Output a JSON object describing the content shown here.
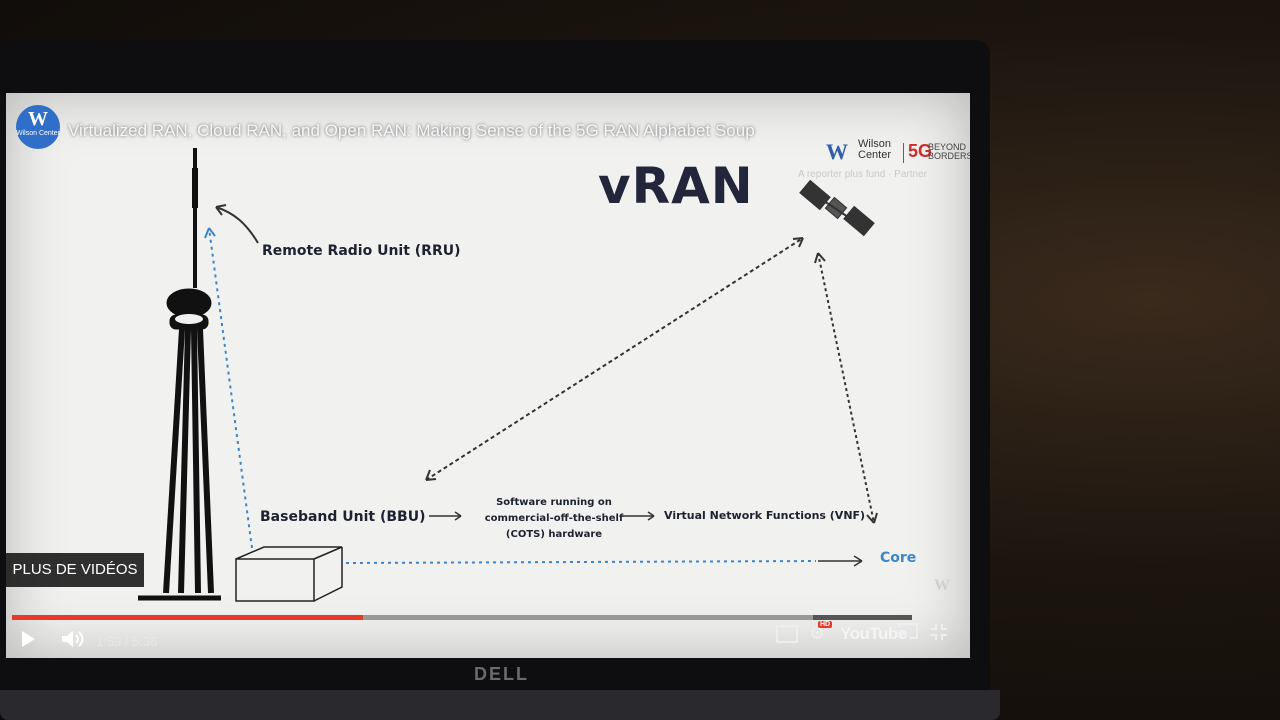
{
  "video": {
    "channel_logo": {
      "letter": "W",
      "text": "Wilson Center"
    },
    "title": "Virtualized RAN, Cloud RAN, and Open RAN: Making Sense of the 5G RAN Alphabet Soup",
    "brand": {
      "w": "W",
      "name": "Wilson Center",
      "five_g": "5G",
      "beyond": "BEYOND BORDERS",
      "sub": "A reporter plus fund · Partner"
    },
    "slide": {
      "heading": "vRAN",
      "rru_label": "Remote Radio Unit (RRU)",
      "bbu_label": "Baseband Unit (BBU)",
      "cots_label": [
        "Software running on",
        "commercial-off-the-shelf",
        "(COTS) hardware"
      ],
      "vnf_label": "Virtual Network Functions (VNF)",
      "core_label": "Core"
    },
    "more_videos": "PLUS DE VIDÉOS",
    "watermark": "W"
  },
  "player": {
    "time": "1:59 / 5:36",
    "progress": 0.39,
    "buffered": 0.89,
    "hd": "HD",
    "youtube": "YouTube",
    "icons": {
      "play": "play-icon",
      "volume": "volume-icon",
      "cc": "captions-icon",
      "settings": "gear-icon",
      "cast": "cast-icon",
      "fullscreen": "fullscreen-exit-icon"
    },
    "colors": {
      "progress": "#e53a2a",
      "buffer": "#999999"
    }
  },
  "device": {
    "brand": "DELL"
  }
}
